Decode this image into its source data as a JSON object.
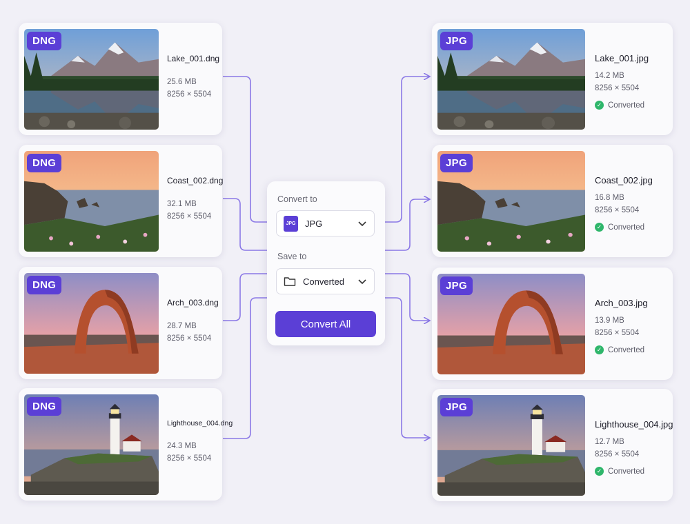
{
  "panel": {
    "convert_label": "Convert to",
    "format_value": "JPG",
    "format_icon_text": "JPG",
    "format_icon": "jpg-file-icon",
    "save_label": "Save to",
    "folder_value": "Converted",
    "folder_icon": "folder-icon",
    "convert_button": "Convert All"
  },
  "source_files": [
    {
      "badge": "DNG",
      "name": "Lake_001.dng",
      "size": "25.6 MB",
      "dims": "8256 × 5504",
      "scene": "lake"
    },
    {
      "badge": "DNG",
      "name": "Coast_002.dng",
      "size": "32.1 MB",
      "dims": "8256 × 5504",
      "scene": "coast"
    },
    {
      "badge": "DNG",
      "name": "Arch_003.dng",
      "size": "28.7 MB",
      "dims": "8256 × 5504",
      "scene": "arch"
    },
    {
      "badge": "DNG",
      "name": "Lighthouse_004.dng",
      "size": "24.3 MB",
      "dims": "8256 × 5504",
      "scene": "lighthouse"
    }
  ],
  "output_files": [
    {
      "badge": "JPG",
      "name": "Lake_001.jpg",
      "size": "14.2 MB",
      "dims": "8256 × 5504",
      "status": "Converted",
      "scene": "lake"
    },
    {
      "badge": "JPG",
      "name": "Coast_002.jpg",
      "size": "16.8 MB",
      "dims": "8256 × 5504",
      "status": "Converted",
      "scene": "coast"
    },
    {
      "badge": "JPG",
      "name": "Arch_003.jpg",
      "size": "13.9 MB",
      "dims": "8256 × 5504",
      "status": "Converted",
      "scene": "arch"
    },
    {
      "badge": "JPG",
      "name": "Lighthouse_004.jpg",
      "size": "12.7 MB",
      "dims": "8256 × 5504",
      "status": "Converted",
      "scene": "lighthouse"
    }
  ],
  "colors": {
    "accent": "#5b3fd6",
    "connector": "#8b78e6",
    "success": "#2fb66b",
    "background": "#f1f0f7"
  }
}
